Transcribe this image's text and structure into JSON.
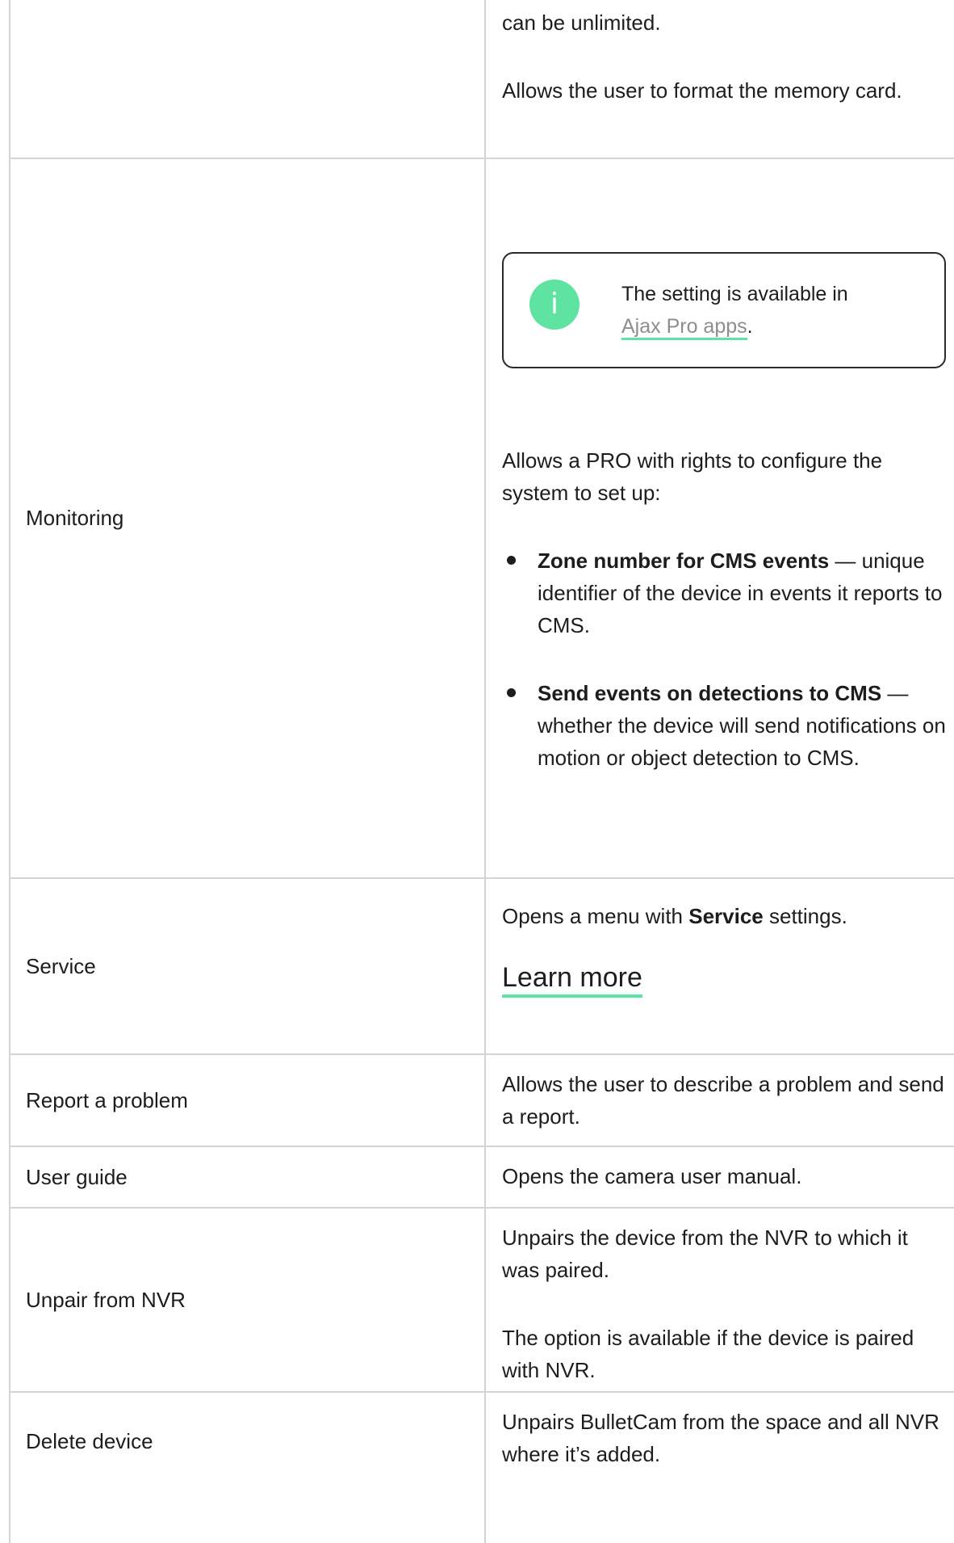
{
  "rows": [
    {
      "label": "",
      "lines": [
        "can be unlimited.",
        "Allows the user to format the memory card."
      ]
    },
    {
      "label": "Monitoring",
      "note": {
        "icon": "info-icon",
        "icon_glyph": "i",
        "text": "The setting is available in",
        "link": "Ajax Pro apps",
        "after": "."
      },
      "intro": "Allows a PRO with rights to configure the system to set up:",
      "bullets": [
        {
          "bold": "Zone number for CMS events",
          "text": " — unique identifier of the device in events it reports to CMS."
        },
        {
          "bold": "Send events on detections to CMS",
          "text": " — whether the device will send notifications on motion or object detection to CMS."
        }
      ]
    },
    {
      "label": "Service",
      "text_before": "Opens a menu with ",
      "bold": "Service",
      "text_after": " settings.",
      "link": "Learn more"
    },
    {
      "label": "Report a problem",
      "text": "Allows the user to describe a problem and send a report."
    },
    {
      "label": "User guide",
      "text": "Opens the camera user manual."
    },
    {
      "label": "Unpair from NVR",
      "p1": "Unpairs the device from the NVR to which it was paired.",
      "p2": "The option is available if the device is paired with NVR."
    },
    {
      "label": "Delete device",
      "text": "Unpairs BulletCam from the space and all NVR where it’s added."
    }
  ],
  "colors": {
    "accent": "#5fe3a1",
    "border": "#d4d4d4",
    "text": "#1d1d1d",
    "muted_link": "#8e8e8e"
  }
}
